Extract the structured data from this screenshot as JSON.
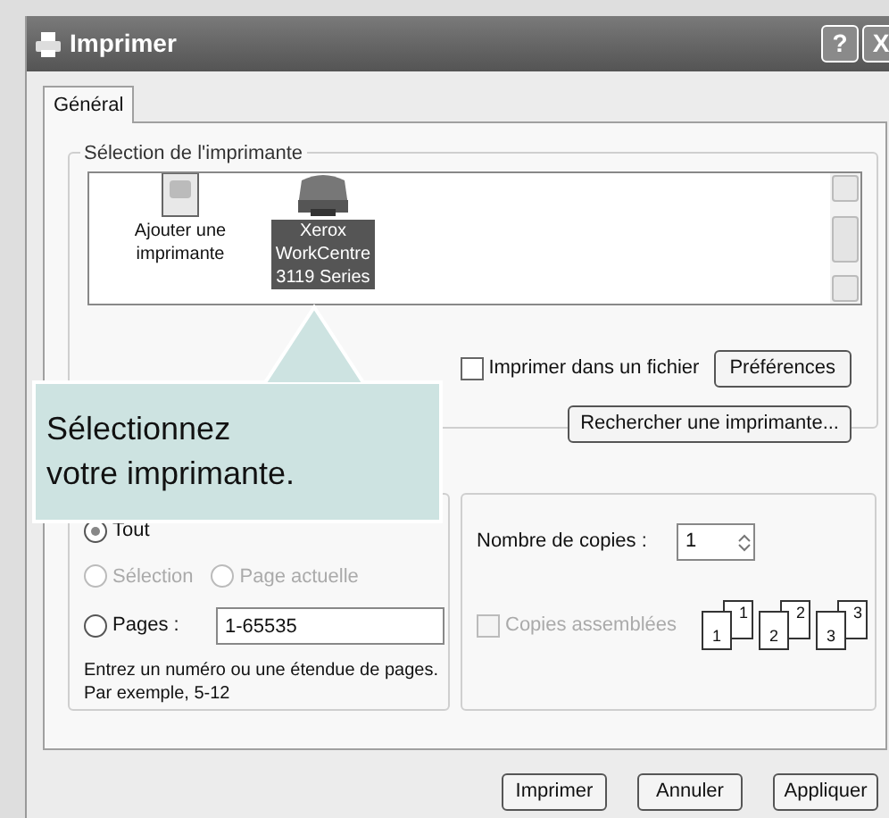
{
  "window": {
    "title": "Imprimer",
    "title_buttons": [
      "?",
      "X"
    ]
  },
  "tabs": [
    {
      "label": "Général",
      "selected": true
    }
  ],
  "printer_selection": {
    "legend": "Sélection de l'imprimante",
    "printers": [
      {
        "kind": "add",
        "label": "Ajouter une imprimante",
        "selected": false
      },
      {
        "kind": "printer",
        "label": "Xerox WorkCentre 3119 Series",
        "selected": true
      }
    ],
    "print_to_file": {
      "label": "Imprimer dans un fichier",
      "checked": false
    },
    "buttons": [
      "Préférences",
      "Rechercher une imprimante..."
    ]
  },
  "callout": {
    "text": "Sélectionnez votre imprimante."
  },
  "page_range": {
    "options": [
      {
        "label": "Tout",
        "selected": true,
        "disabled": false
      },
      {
        "label": "Sélection",
        "selected": false,
        "disabled": true
      },
      {
        "label": "Page actuelle",
        "selected": false,
        "disabled": true
      },
      {
        "label": "Pages :",
        "selected": false,
        "disabled": false
      }
    ],
    "pages_value": "1-65535",
    "hint": "Entrez un numéro ou une étendue de pages. Par exemple, 5-12"
  },
  "copies": {
    "label": "Nombre de copies :",
    "value": "1",
    "collate": {
      "label": "Copies assemblées",
      "checked": false,
      "disabled": true
    },
    "collate_pages": [
      {
        "front": "1",
        "back": "1"
      },
      {
        "front": "2",
        "back": "2"
      },
      {
        "front": "3",
        "back": "3"
      }
    ]
  },
  "footer_buttons": [
    "Imprimer",
    "Annuler",
    "Appliquer"
  ]
}
